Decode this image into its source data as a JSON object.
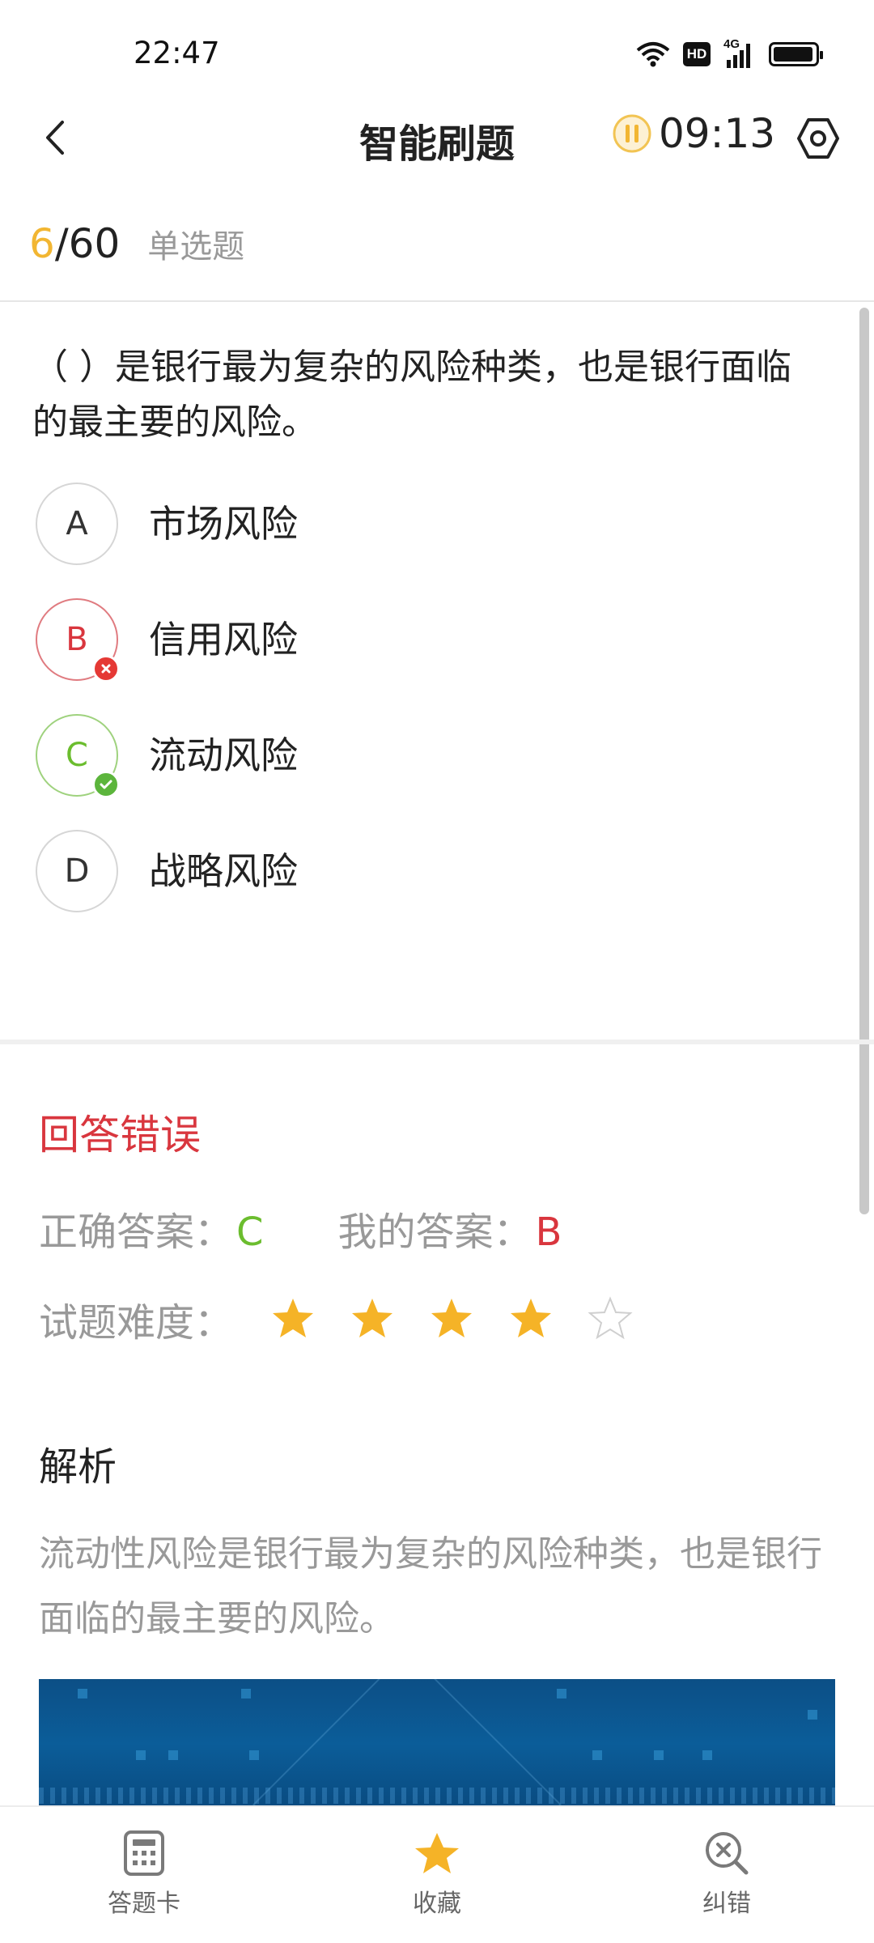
{
  "status_bar": {
    "time": "22:47",
    "icons": [
      "wifi-icon",
      "hd-icon",
      "4g-signal-icon",
      "battery-icon"
    ],
    "hd_text": "HD",
    "network_text": "4G"
  },
  "nav": {
    "title": "智能刷题",
    "timer": "09:13"
  },
  "question_header": {
    "current": "6",
    "total": "60",
    "slash": "/",
    "type": "单选题"
  },
  "question": {
    "text": "（ ）是银行最为复杂的风险种类，也是银行面临的最主要的风险。",
    "options": [
      {
        "letter": "A",
        "text": "市场风险",
        "state": "normal"
      },
      {
        "letter": "B",
        "text": "信用风险",
        "state": "wrong"
      },
      {
        "letter": "C",
        "text": "流动风险",
        "state": "right"
      },
      {
        "letter": "D",
        "text": "战略风险",
        "state": "normal"
      }
    ]
  },
  "result": {
    "title": "回答错误",
    "correct_label": "正确答案：",
    "correct_value": "C",
    "mine_label": "我的答案：",
    "mine_value": "B",
    "difficulty_label": "试题难度：",
    "difficulty": 4,
    "difficulty_max": 5
  },
  "analysis": {
    "title": "解析",
    "text": "流动性风险是银行最为复杂的风险种类，也是银行面临的最主要的风险。"
  },
  "bottom_nav": {
    "items": [
      {
        "label": "答题卡",
        "icon": "answer-card-icon"
      },
      {
        "label": "收藏",
        "icon": "star-icon"
      },
      {
        "label": "纠错",
        "icon": "error-search-icon"
      }
    ]
  },
  "colors": {
    "accent": "#f2b632",
    "wrong": "#d9363e",
    "right": "#6bbd2e",
    "muted": "#999999"
  }
}
